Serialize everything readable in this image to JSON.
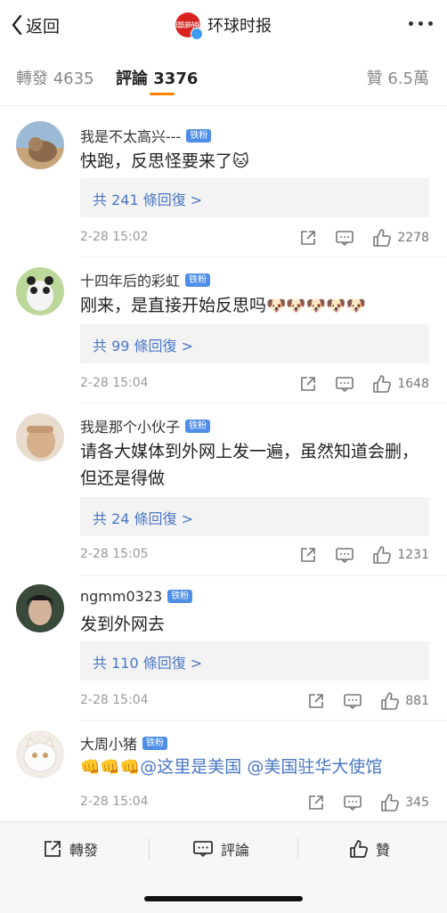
{
  "nav": {
    "back_label": "返回",
    "account_name": "环球时报",
    "logo_text": "環球時報"
  },
  "tabs": {
    "repost": "轉發 4635",
    "comments": "評論 3376",
    "likes": "贊 6.5萬"
  },
  "comments": [
    {
      "user": "我是不太高兴---",
      "badge": "铁粉",
      "text": "快跑，反思怪要来了",
      "emoji": "🐱",
      "replies": "共 241 條回復 >",
      "time": "2-28 15:02",
      "likes": "2278"
    },
    {
      "user": "十四年后的彩虹",
      "badge": "铁粉",
      "text": "刚来，是直接开始反思吗",
      "emoji": "🐶🐶🐶🐶🐶",
      "replies": "共 99 條回復 >",
      "time": "2-28 15:04",
      "likes": "1648"
    },
    {
      "user": "我是那个小伙子",
      "badge": "铁粉",
      "text": "请各大媒体到外网上发一遍，虽然知道会删，但还是得做",
      "emoji": "",
      "replies": "共 24 條回復 >",
      "time": "2-28 15:05",
      "likes": "1231"
    },
    {
      "user": "ngmm0323",
      "badge": "铁粉",
      "text": "发到外网去",
      "emoji": "",
      "replies": "共 110 條回復 >",
      "time": "2-28 15:04",
      "likes": "881"
    },
    {
      "user": "大周小猪",
      "badge": "铁粉",
      "emoji_prefix": "👊👊👊",
      "mention1": "@这里是美国",
      "mention2": "@美国驻华大使馆",
      "time": "2-28 15:04",
      "likes": "345"
    }
  ],
  "bottom_bar": {
    "repost": "轉發",
    "comment": "評論",
    "like": "贊"
  },
  "icons": [
    "chevron-left-icon",
    "more-icon",
    "share-icon",
    "comment-icon",
    "like-icon"
  ],
  "colors": {
    "accent": "#ff8200",
    "link": "#4a77c4",
    "fan_badge": "#4e8ee8",
    "brand_red": "#d8231f"
  }
}
